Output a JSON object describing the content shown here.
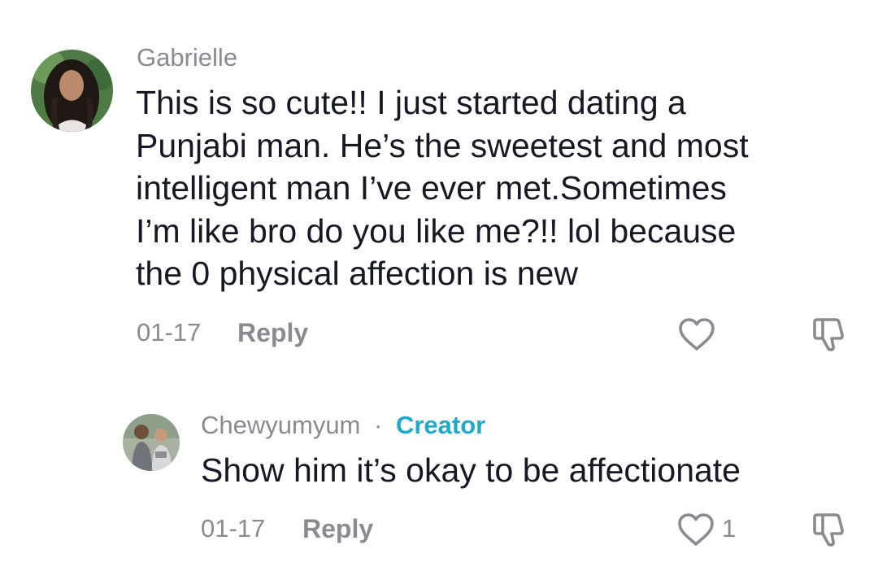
{
  "colors": {
    "text_primary": "#161823",
    "text_secondary": "#8a8b91",
    "creator_accent": "#20a9c9",
    "background": "#ffffff"
  },
  "comments": [
    {
      "username": "Gabrielle",
      "avatar_icon": "user-avatar-photo",
      "lines": [
        "This is so cute!! I just started dating a",
        "Punjabi man. He’s the sweetest and most",
        "intelligent man I’ve ever met.Sometimes",
        "I’m like bro do you like me?!! lol because",
        "the 0 physical affection is new"
      ],
      "date": "01-17",
      "reply_label": "Reply",
      "like_icon": "heart-outline-icon",
      "dislike_icon": "thumbs-down-outline-icon"
    },
    {
      "username": "Chewyumyum",
      "separator": "·",
      "badge": "Creator",
      "avatar_icon": "creator-avatar-photo",
      "lines": [
        "Show him it’s okay to be affectionate"
      ],
      "date": "01-17",
      "reply_label": "Reply",
      "like_count": "1",
      "like_icon": "heart-outline-icon",
      "dislike_icon": "thumbs-down-outline-icon"
    }
  ]
}
